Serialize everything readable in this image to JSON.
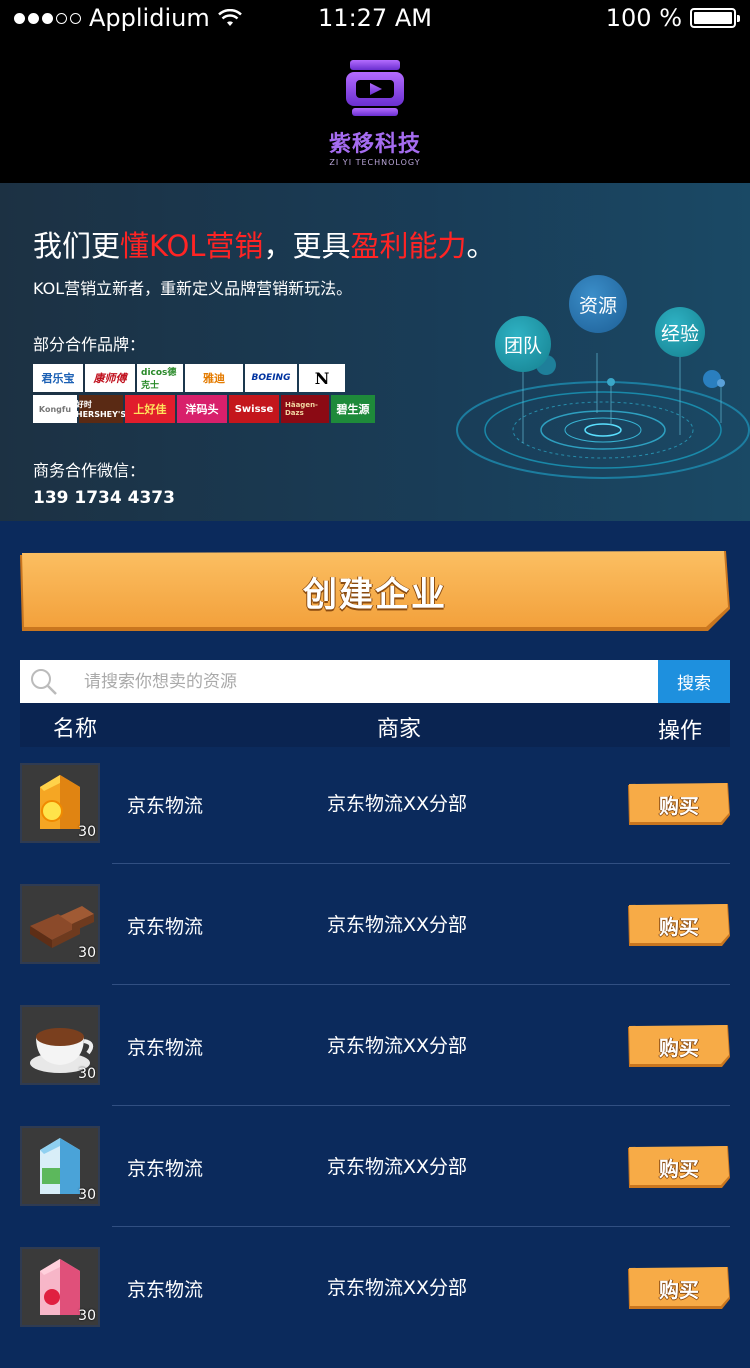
{
  "status": {
    "carrier": "Applidium",
    "time": "11:27 AM",
    "battery": "100 %"
  },
  "logo": {
    "name": "紫移科技",
    "sub": "ZI YI TECHNOLOGY"
  },
  "banner": {
    "headline_1": "我们更",
    "headline_2": "懂KOL营销",
    "headline_3": "，更具",
    "headline_4": "盈利能力",
    "headline_5": "。",
    "subline": "KOL营销立新者，重新定义品牌营销新玩法。",
    "partners_label": "部分合作品牌：",
    "brands": [
      "君乐宝",
      "康师傅",
      "dicos德克士",
      "雅迪",
      "BOEING",
      "N",
      "Kongfu",
      "好时HERSHEY'S",
      "上好佳",
      "洋码头",
      "Swisse",
      "Häagen-Dazs",
      "碧生源"
    ],
    "wechat_label": "商务合作微信：",
    "phone": "139 1734 4373",
    "circles": {
      "team": "团队",
      "resource": "资源",
      "experience": "经验"
    }
  },
  "create_button": "创建企业",
  "search": {
    "placeholder": "请搜索你想卖的资源",
    "button": "搜索"
  },
  "table": {
    "headers": {
      "name": "名称",
      "merchant": "商家",
      "action": "操作"
    },
    "rows": [
      {
        "thumb": "juice-carton-icon",
        "count": "30",
        "name": "京东物流",
        "merchant": "京东物流XX分部",
        "action": "购买"
      },
      {
        "thumb": "chocolate-icon",
        "count": "30",
        "name": "京东物流",
        "merchant": "京东物流XX分部",
        "action": "购买"
      },
      {
        "thumb": "coffee-cup-icon",
        "count": "30",
        "name": "京东物流",
        "merchant": "京东物流XX分部",
        "action": "购买"
      },
      {
        "thumb": "milk-carton-icon",
        "count": "30",
        "name": "京东物流",
        "merchant": "京东物流XX分部",
        "action": "购买"
      },
      {
        "thumb": "strawberry-milk-icon",
        "count": "30",
        "name": "京东物流",
        "merchant": "京东物流XX分部",
        "action": "购买"
      }
    ]
  },
  "colors": {
    "accent_red": "#ff2424",
    "button_orange": "#f5a84a",
    "search_blue": "#1e90de",
    "logo_purple": "#a56cf0"
  }
}
